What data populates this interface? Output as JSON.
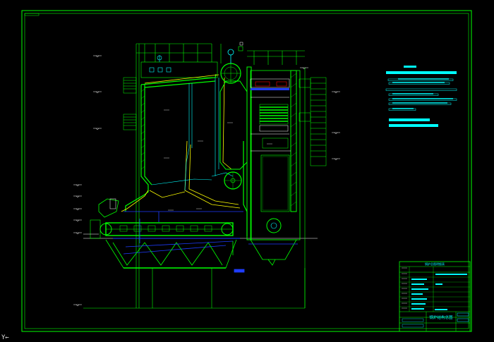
{
  "drawing": {
    "background": "#000000",
    "colors": {
      "frame": "#00ff00",
      "cyan": "#00ffff",
      "yellow": "#ffff00",
      "blue": "#1e3cff",
      "white": "#ffffff",
      "red": "#ff0000"
    },
    "title_block": {
      "header": "锅炉总图明细表",
      "drawing_name": "锅炉结构总图"
    },
    "axis_indicator": "Y←"
  }
}
